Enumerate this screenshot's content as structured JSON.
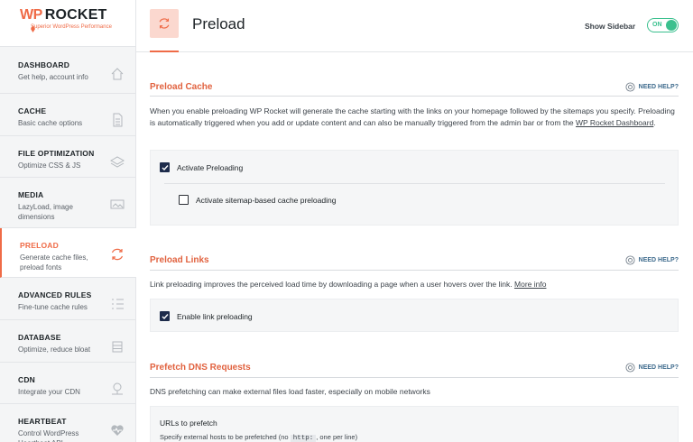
{
  "logo": {
    "wp": "WP",
    "rocket": "ROCKET",
    "tagline": "Superior WordPress Performance"
  },
  "sidebar": {
    "items": [
      {
        "title": "DASHBOARD",
        "desc": "Get help, account info",
        "icon": "home-icon"
      },
      {
        "title": "CACHE",
        "desc": "Basic cache options",
        "icon": "file-icon"
      },
      {
        "title": "FILE OPTIMIZATION",
        "desc": "Optimize CSS & JS",
        "icon": "layers-icon"
      },
      {
        "title": "MEDIA",
        "desc": "LazyLoad, image dimensions",
        "icon": "image-icon"
      },
      {
        "title": "PRELOAD",
        "desc": "Generate cache files, preload fonts",
        "icon": "refresh-icon"
      },
      {
        "title": "ADVANCED RULES",
        "desc": "Fine-tune cache rules",
        "icon": "list-icon"
      },
      {
        "title": "DATABASE",
        "desc": "Optimize, reduce bloat",
        "icon": "database-icon"
      },
      {
        "title": "CDN",
        "desc": "Integrate your CDN",
        "icon": "cdn-icon"
      },
      {
        "title": "HEARTBEAT",
        "desc": "Control WordPress Heartbeat API",
        "icon": "heartbeat-icon"
      }
    ]
  },
  "header": {
    "title": "Preload",
    "show_sidebar": "Show Sidebar",
    "toggle": "ON"
  },
  "sections": {
    "preload_cache": {
      "title": "Preload Cache",
      "help": "NEED HELP?",
      "desc_pre": "When you enable preloading WP Rocket will generate the cache starting with the links on your homepage followed by the sitemaps you specify. Preloading is automatically triggered when you add or update content and can also be manually triggered from the admin bar or from the ",
      "desc_link": "WP Rocket Dashboard",
      "desc_post": ".",
      "opt1": "Activate Preloading",
      "opt2": "Activate sitemap-based cache preloading"
    },
    "preload_links": {
      "title": "Preload Links",
      "help": "NEED HELP?",
      "desc": "Link preloading improves the perceived load time by downloading a page when a user hovers over the link.",
      "more": "More info",
      "opt1": "Enable link preloading"
    },
    "prefetch": {
      "title": "Prefetch DNS Requests",
      "help": "NEED HELP?",
      "desc": "DNS prefetching can make external files load faster, especially on mobile networks",
      "urls_label": "URLs to prefetch",
      "urls_help_pre": "Specify external hosts to be prefetched (no",
      "urls_code": "http:",
      "urls_help_post": ", one per line)"
    }
  },
  "colors": {
    "accent": "#ef6b47",
    "toggle": "#3ac08e",
    "checkbox": "#1d2b4b"
  }
}
